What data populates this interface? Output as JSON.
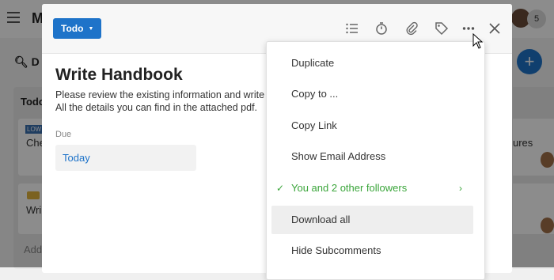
{
  "background": {
    "app_title": "M",
    "search_text": "D",
    "column_title": "Todo",
    "card1_badge": "LOW",
    "card1_text": "Che",
    "card2_text": "Wri",
    "add_text": "Add",
    "right_card_text": "ures",
    "member_count": "5"
  },
  "modal": {
    "status_label": "Todo",
    "title": "Write Handbook",
    "description_line1": "Please review the existing information and write",
    "description_line2": "All the details you can find in the attached pdf.",
    "due_label": "Due",
    "due_value": "Today"
  },
  "menu": {
    "items": [
      {
        "label": "Duplicate"
      },
      {
        "label": "Copy to ..."
      },
      {
        "label": "Copy Link"
      },
      {
        "label": "Show Email Address"
      },
      {
        "label": "You and 2 other followers"
      },
      {
        "label": "Download all"
      },
      {
        "label": "Hide Subcomments"
      }
    ]
  },
  "colors": {
    "accent": "#1e73c9",
    "followers_green": "#3aa53a",
    "highlight": "#eeeeee"
  }
}
